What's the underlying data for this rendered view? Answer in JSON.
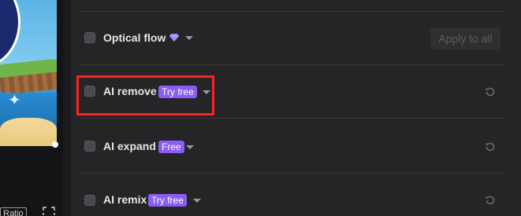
{
  "preview": {
    "ratio_label": "Ratio",
    "fullscreen_icon": "fullscreen-expand-icon"
  },
  "panel": {
    "rows": [
      {
        "label": "Optical flow",
        "premium_icon": "diamond-icon",
        "apply_label": "Apply to all"
      },
      {
        "label": "AI remove",
        "badge": "Try free",
        "reset_icon": "reset-icon"
      },
      {
        "label": "AI expand",
        "badge": "Free",
        "reset_icon": "reset-icon"
      },
      {
        "label": "AI remix",
        "badge": "Try free",
        "reset_icon": "reset-icon"
      }
    ]
  },
  "colors": {
    "panel_bg": "#252527",
    "badge": "#8b5cf6",
    "highlight": "#ff2020",
    "diamond": "#a78bfa"
  }
}
